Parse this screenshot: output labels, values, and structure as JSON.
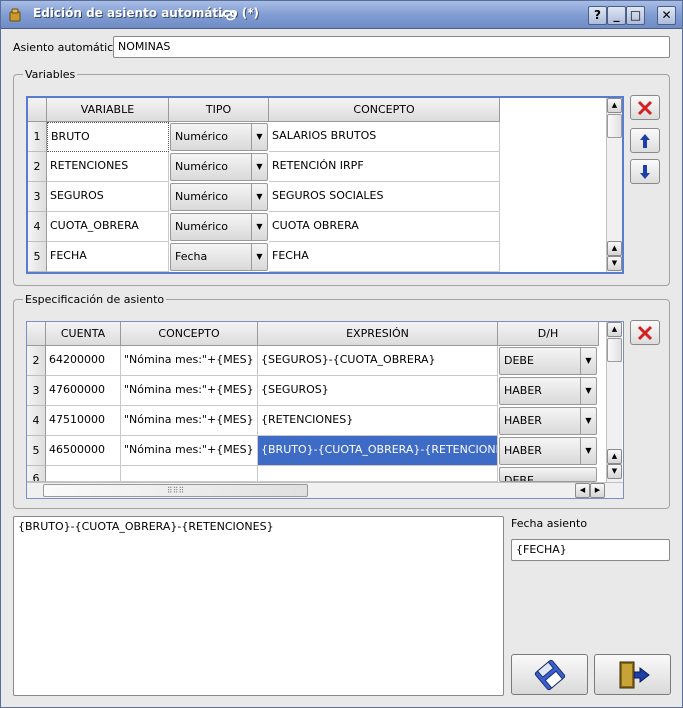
{
  "window": {
    "title": "Edición de asiento automático (*)",
    "buttons": [
      "?",
      "_",
      "□",
      "✕"
    ]
  },
  "asiento": {
    "label": "Asiento automático:",
    "value": "NOMINAS"
  },
  "variables": {
    "group_title": "Variables",
    "columns": [
      "VARIABLE",
      "TIPO",
      "CONCEPTO"
    ],
    "rows": [
      {
        "num": "1",
        "variable": "BRUTO",
        "tipo": "Numérico",
        "concepto": "SALARIOS BRUTOS"
      },
      {
        "num": "2",
        "variable": "RETENCIONES",
        "tipo": "Numérico",
        "concepto": "RETENCIÓN IRPF"
      },
      {
        "num": "3",
        "variable": "SEGUROS",
        "tipo": "Numérico",
        "concepto": "SEGUROS SOCIALES"
      },
      {
        "num": "4",
        "variable": "CUOTA_OBRERA",
        "tipo": "Numérico",
        "concepto": "CUOTA OBRERA"
      },
      {
        "num": "5",
        "variable": "FECHA",
        "tipo": "Fecha",
        "concepto": "FECHA"
      }
    ]
  },
  "especificacion": {
    "group_title": "Especificación de asiento",
    "columns": [
      "CUENTA",
      "CONCEPTO",
      "EXPRESIÓN",
      "D/H"
    ],
    "rows": [
      {
        "num": "2",
        "cuenta": "64200000",
        "concepto": "\"Nómina mes:\"+{MES}",
        "expresion": "{SEGUROS}-{CUOTA_OBRERA}",
        "dh": "DEBE"
      },
      {
        "num": "3",
        "cuenta": "47600000",
        "concepto": "\"Nómina mes:\"+{MES}",
        "expresion": "{SEGUROS}",
        "dh": "HABER"
      },
      {
        "num": "4",
        "cuenta": "47510000",
        "concepto": "\"Nómina mes:\"+{MES}",
        "expresion": "{RETENCIONES}",
        "dh": "HABER"
      },
      {
        "num": "5",
        "cuenta": "46500000",
        "concepto": "\"Nómina mes:\"+{MES}",
        "expresion": "{BRUTO}-{CUOTA_OBRERA}-{RETENCIONES}",
        "dh": "HABER"
      },
      {
        "num": "6",
        "cuenta": "",
        "concepto": "",
        "expresion": "",
        "dh": "DEBE"
      }
    ]
  },
  "expression_text": "{BRUTO}-{CUOTA_OBRERA}-{RETENCIONES}",
  "fecha": {
    "label": "Fecha asiento",
    "value": "{FECHA}"
  },
  "colors": {
    "selection": "#3d6bc6",
    "delete_red": "#d42020",
    "arrow_blue": "#1f3fa8",
    "titlebar": "#7f9bd2"
  },
  "icons": [
    "window-icon",
    "delete-icon",
    "arrow-up-icon",
    "arrow-down-icon",
    "save-icon",
    "exit-icon"
  ]
}
